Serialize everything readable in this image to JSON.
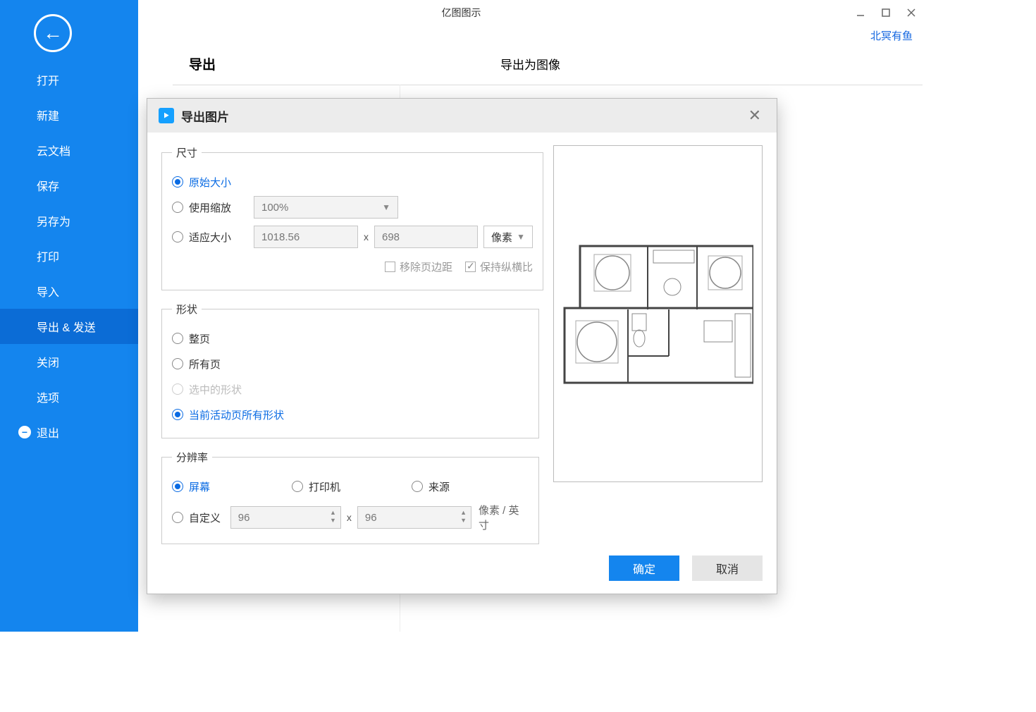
{
  "app_title": "亿图图示",
  "user_link": "北冥有鱼",
  "sidebar": {
    "items": [
      {
        "label": "打开"
      },
      {
        "label": "新建"
      },
      {
        "label": "云文档"
      },
      {
        "label": "保存"
      },
      {
        "label": "另存为"
      },
      {
        "label": "打印"
      },
      {
        "label": "导入"
      },
      {
        "label": "导出 & 发送"
      },
      {
        "label": "关闭"
      },
      {
        "label": "选项"
      },
      {
        "label": "退出"
      }
    ]
  },
  "header": {
    "export": "导出",
    "export_as_image": "导出为图像"
  },
  "dialog": {
    "title": "导出图片",
    "size": {
      "legend": "尺寸",
      "original": "原始大小",
      "use_zoom": "使用缩放",
      "fit": "适应大小",
      "zoom_value": "100%",
      "width": "1018.56",
      "height": "698",
      "x": "x",
      "unit": "像素",
      "remove_margin": "移除页边距",
      "keep_aspect": "保持纵横比"
    },
    "shape": {
      "legend": "形状",
      "whole_page": "整页",
      "all_pages": "所有页",
      "selected": "选中的形状",
      "active_all": "当前活动页所有形状"
    },
    "resolution": {
      "legend": "分辨率",
      "screen": "屏幕",
      "printer": "打印机",
      "source": "来源",
      "custom": "自定义",
      "dpi_x": "96",
      "dpi_y": "96",
      "unit": "像素 / 英寸",
      "x": "x"
    },
    "ok": "确定",
    "cancel": "取消"
  }
}
